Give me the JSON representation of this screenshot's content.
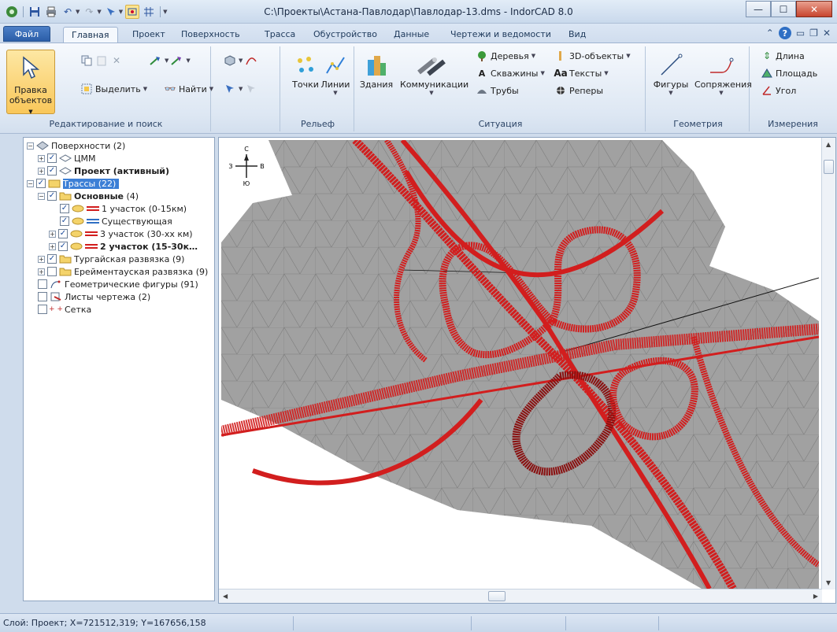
{
  "window": {
    "title": "C:\\Проекты\\Астана-Павлодар\\Павлодар-13.dms - IndorCAD 8.0"
  },
  "tabs": {
    "file": "Файл",
    "items": [
      "Главная",
      "Проект",
      "Поверхность",
      "Трасса",
      "Обустройство",
      "Данные",
      "Чертежи и ведомости",
      "Вид"
    ],
    "active": "Главная"
  },
  "ribbon": {
    "edit": {
      "pravka_line1": "Правка",
      "pravka_line2": "объектов",
      "select": "Выделить",
      "find": "Найти",
      "label": "Редактирование и поиск"
    },
    "relief": {
      "points": "Точки",
      "lines": "Линии",
      "label": "Рельеф"
    },
    "situation": {
      "buildings": "Здания",
      "communications": "Коммуникации",
      "trees": "Деревья",
      "wells": "Скважины",
      "pipes": "Трубы",
      "objects3d": "3D-объекты",
      "texts": "Тексты",
      "benchmarks": "Реперы",
      "label": "Ситуация"
    },
    "geometry": {
      "figures": "Фигуры",
      "conjugations": "Сопряжения",
      "label": "Геометрия"
    },
    "measure": {
      "length": "Длина",
      "area": "Площадь",
      "angle": "Угол",
      "label": "Измерения"
    }
  },
  "tree": {
    "items": [
      {
        "label": "Поверхности (2)"
      },
      {
        "label": "ЦММ"
      },
      {
        "label": "Проект (активный)"
      },
      {
        "label": "Трассы (22)"
      },
      {
        "label": "Основные",
        "suffix": " (4)"
      },
      {
        "label": "1 участок (0-15км)"
      },
      {
        "label": "Существующая"
      },
      {
        "label": "3 участок (30-хх км)"
      },
      {
        "label": "2 участок (15-30к…"
      },
      {
        "label": "Тургайская развязка (9)"
      },
      {
        "label": "Ерейментауская развязка (9)"
      },
      {
        "label": "Геометрические фигуры (91)"
      },
      {
        "label": "Листы чертежа (2)"
      },
      {
        "label": "Сетка"
      }
    ]
  },
  "compass": {
    "n": "С",
    "s": "Ю",
    "w": "З",
    "e": "В"
  },
  "status": {
    "text": "Слой: Проект; X=721512,319; Y=167656,158"
  },
  "colors": {
    "accent": "#3c7fd6",
    "road": "#d21e1e",
    "terrain": "#9b9b9b"
  }
}
